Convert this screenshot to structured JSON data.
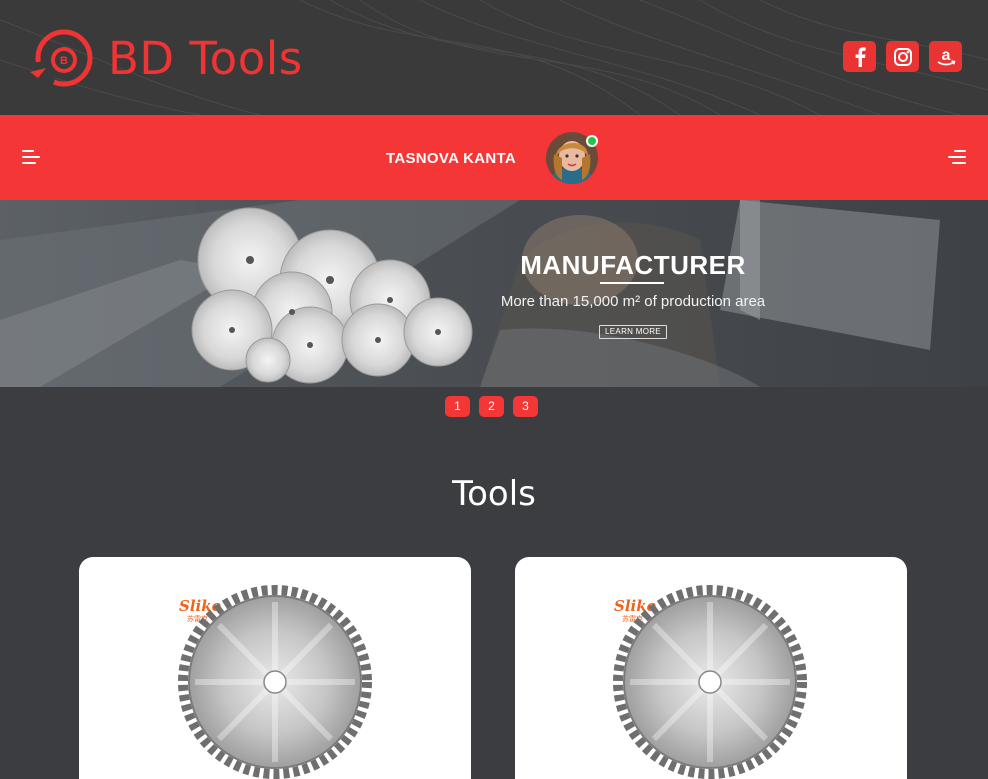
{
  "header": {
    "logo_letter": "B",
    "logo_text": "BD Tools",
    "socials": [
      {
        "name": "facebook",
        "glyph": "f"
      },
      {
        "name": "instagram",
        "glyph": ""
      },
      {
        "name": "amazon",
        "glyph": "a"
      }
    ]
  },
  "navbar": {
    "user_name": "TASNOVA KANTA",
    "status": "online"
  },
  "hero": {
    "title": "MANUFACTURER",
    "subtitle": "More than 15,000 m² of production area",
    "button_label": "LEARN MORE"
  },
  "pager": [
    "1",
    "2",
    "3"
  ],
  "section": {
    "title": "Tools"
  },
  "products": [
    {
      "brand": "Slike",
      "brand_sub": "苏雷克"
    },
    {
      "brand": "Slike",
      "brand_sub": "苏雷克"
    }
  ],
  "colors": {
    "accent": "#f53636",
    "header_bg": "#3a3a3a",
    "page_bg": "#3b3d40",
    "online": "#27c24c"
  }
}
